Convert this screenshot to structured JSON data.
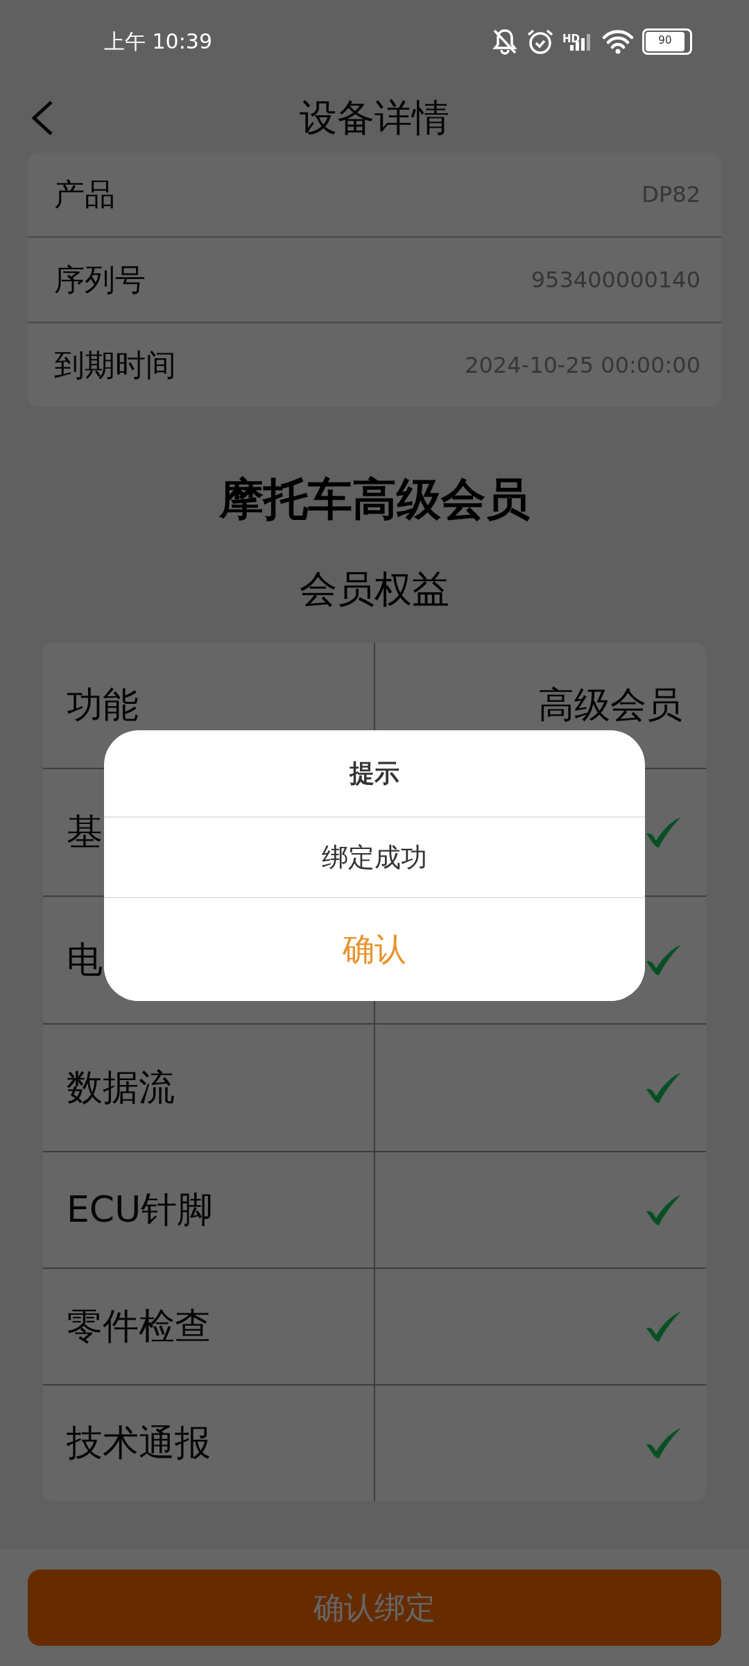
{
  "status_bar": {
    "time": "上午 10:39",
    "network": "HD",
    "battery": "90"
  },
  "nav": {
    "title": "设备详情"
  },
  "device_info": [
    {
      "label": "产品",
      "value": "DP82"
    },
    {
      "label": "序列号",
      "value": "953400000140"
    },
    {
      "label": "到期时间",
      "value": "2024-10-25 00:00:00"
    }
  ],
  "plan_title": "摩托车高级会员",
  "benefits_title": "会员权益",
  "table": {
    "columns": [
      "功能",
      "高级会员"
    ],
    "rows": [
      {
        "feature": "基",
        "included": true
      },
      {
        "feature": "电",
        "included": true
      },
      {
        "feature": "数据流",
        "included": true
      },
      {
        "feature": "ECU针脚",
        "included": true
      },
      {
        "feature": "零件检查",
        "included": true
      },
      {
        "feature": "技术通报",
        "included": true
      }
    ]
  },
  "bind_button": "确认绑定",
  "dialog": {
    "title": "提示",
    "message": "绑定成功",
    "confirm": "确认"
  }
}
